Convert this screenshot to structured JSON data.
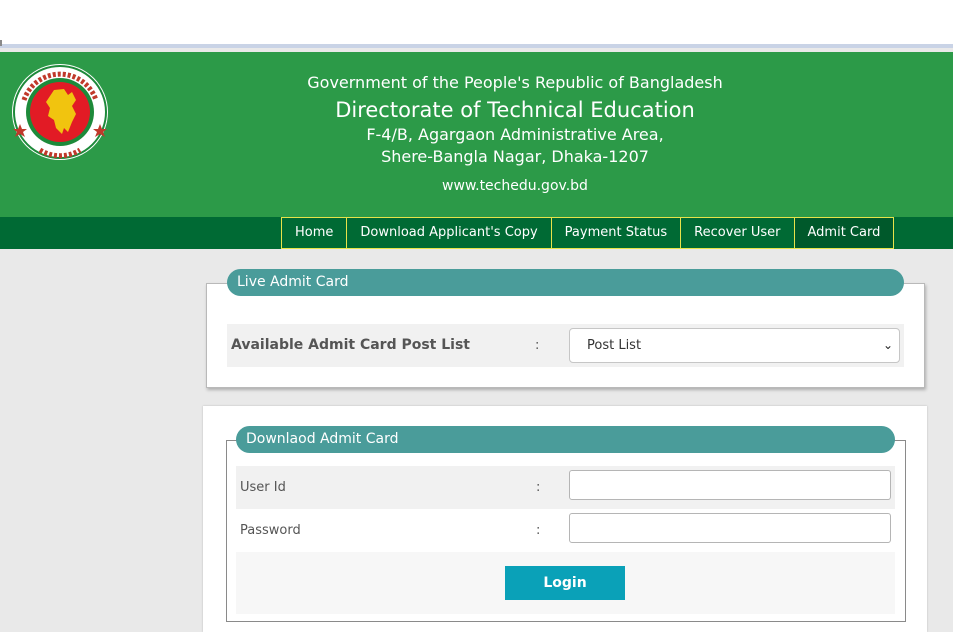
{
  "header": {
    "government": "Government of the People's Republic of Bangladesh",
    "directorate": "Directorate of Technical Education",
    "address_line1": "F-4/B, Agargaon Administrative Area,",
    "address_line2": "Shere-Bangla Nagar, Dhaka-1207",
    "website": "www.techedu.gov.bd",
    "seal_icon": "bangladesh-government-seal-icon"
  },
  "nav": {
    "items": [
      {
        "label": "Home"
      },
      {
        "label": "Download Applicant's Copy"
      },
      {
        "label": "Payment Status"
      },
      {
        "label": "Recover User"
      },
      {
        "label": "Admit Card"
      }
    ],
    "active": "Admit Card"
  },
  "live_admit": {
    "legend": "Live Admit Card",
    "label": "Available Admit Card Post List",
    "colon": ":",
    "select_value": "Post List"
  },
  "download_admit": {
    "legend": "Downlaod Admit Card",
    "user_id_label": "User Id",
    "password_label": "Password",
    "colon": ":",
    "user_id_value": "",
    "password_value": "",
    "login_label": "Login"
  },
  "colors": {
    "header_green": "#2c9a48",
    "nav_green": "#006a34",
    "nav_border": "#e8e34a",
    "legend_teal": "#4a9c9a",
    "login_button": "#0aa1b8"
  }
}
